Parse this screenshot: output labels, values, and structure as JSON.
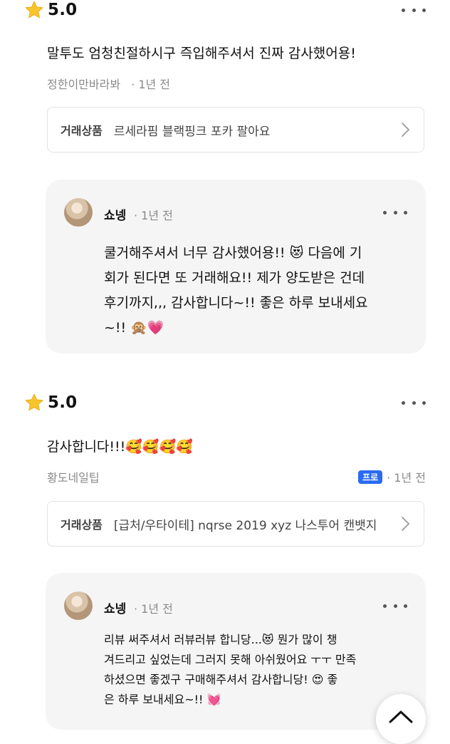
{
  "reviews": [
    {
      "score": "5.0",
      "text": "말투도 엄청친절하시구 즉입해주셔서 진짜 감사했어용!",
      "author": "정한이만바라봐",
      "time": "· 1년 전",
      "product_label": "거래상품",
      "product_name": "르세라핌 블랙핑크 포카 팔아요",
      "reply": {
        "name": "쇼넹",
        "time": "· 1년 전",
        "text": "쿨거해주셔서 너무 감사했어용!! 😻 다음에 기\n회가 된다면 또 거래해요!! 제가 양도받은 건데\n후기까지,,, 감사합니다~!! 좋은 하루 보내세요\n~!! 🙊💗"
      }
    },
    {
      "score": "5.0",
      "text": "감사합니다!!!🥰🥰🥰🥰",
      "author": "황도네일팁",
      "badge": "프로",
      "time": "· 1년 전",
      "product_label": "거래상품",
      "product_name": "[급처/우타이테] nqrse 2019 xyz 나스투어 캔뱃지",
      "reply": {
        "name": "쇼넹",
        "time": "· 1년 전",
        "text": "리뷰 써주셔서 러뷰러뷰 합니당...😻     뭔가 많이 챙\n겨드리고 싶었는데 그러지 못해 아쉬웠어요 ㅜㅜ 만족\n하셨으면 좋겠구 구매해주셔서 감사합니당! 😍     좋\n은 하루 보내세요~!! 💓"
      }
    }
  ],
  "icons": {
    "star": "star-icon",
    "more": "more-dots-icon",
    "chevron": "chevron-right-icon",
    "scroll_top": "chevron-up-icon"
  },
  "colors": {
    "star": "#f7c52b",
    "badge": "#2b6bf3"
  }
}
